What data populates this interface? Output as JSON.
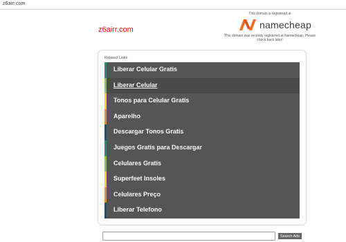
{
  "browser": {
    "url": "z6airr.com"
  },
  "site": {
    "domain_title": "z6airr.com"
  },
  "registrar": {
    "top_text": "This domain is registered at",
    "logo_name": "namecheap",
    "logo_icon": "namecheap-logo-icon",
    "bottom_text": "This domain was recently registered at Namecheap. Please check back later!"
  },
  "related": {
    "title": "Related Links",
    "items": [
      {
        "label": "Liberar Celular Gratis",
        "accent": "#2e8b7a"
      },
      {
        "label": "Liberar Celular",
        "accent": "#8dc63f"
      },
      {
        "label": "Tonos para Celular Gratis",
        "accent": "#f7d21e"
      },
      {
        "label": "Aparelho",
        "accent": "#f08a1c"
      },
      {
        "label": "Descargar Tonos Gratis",
        "accent": "#1f4f6b"
      },
      {
        "label": "Juegos Gratis para Descargar",
        "accent": "#2e8b7a"
      },
      {
        "label": "Celulares Gratis",
        "accent": "#8dc63f"
      },
      {
        "label": "Superfeet Insoles",
        "accent": "#f7d21e"
      },
      {
        "label": "Celulares Preço",
        "accent": "#f08a1c"
      },
      {
        "label": "Liberar Telefono",
        "accent": "#1f4f6b"
      }
    ]
  },
  "search": {
    "value": "",
    "placeholder": "",
    "button_label": "Search Ads"
  },
  "colors": {
    "brand_red": "#d61b1b",
    "namecheap_orange": "#f26a22",
    "panel_bg": "#555555"
  }
}
